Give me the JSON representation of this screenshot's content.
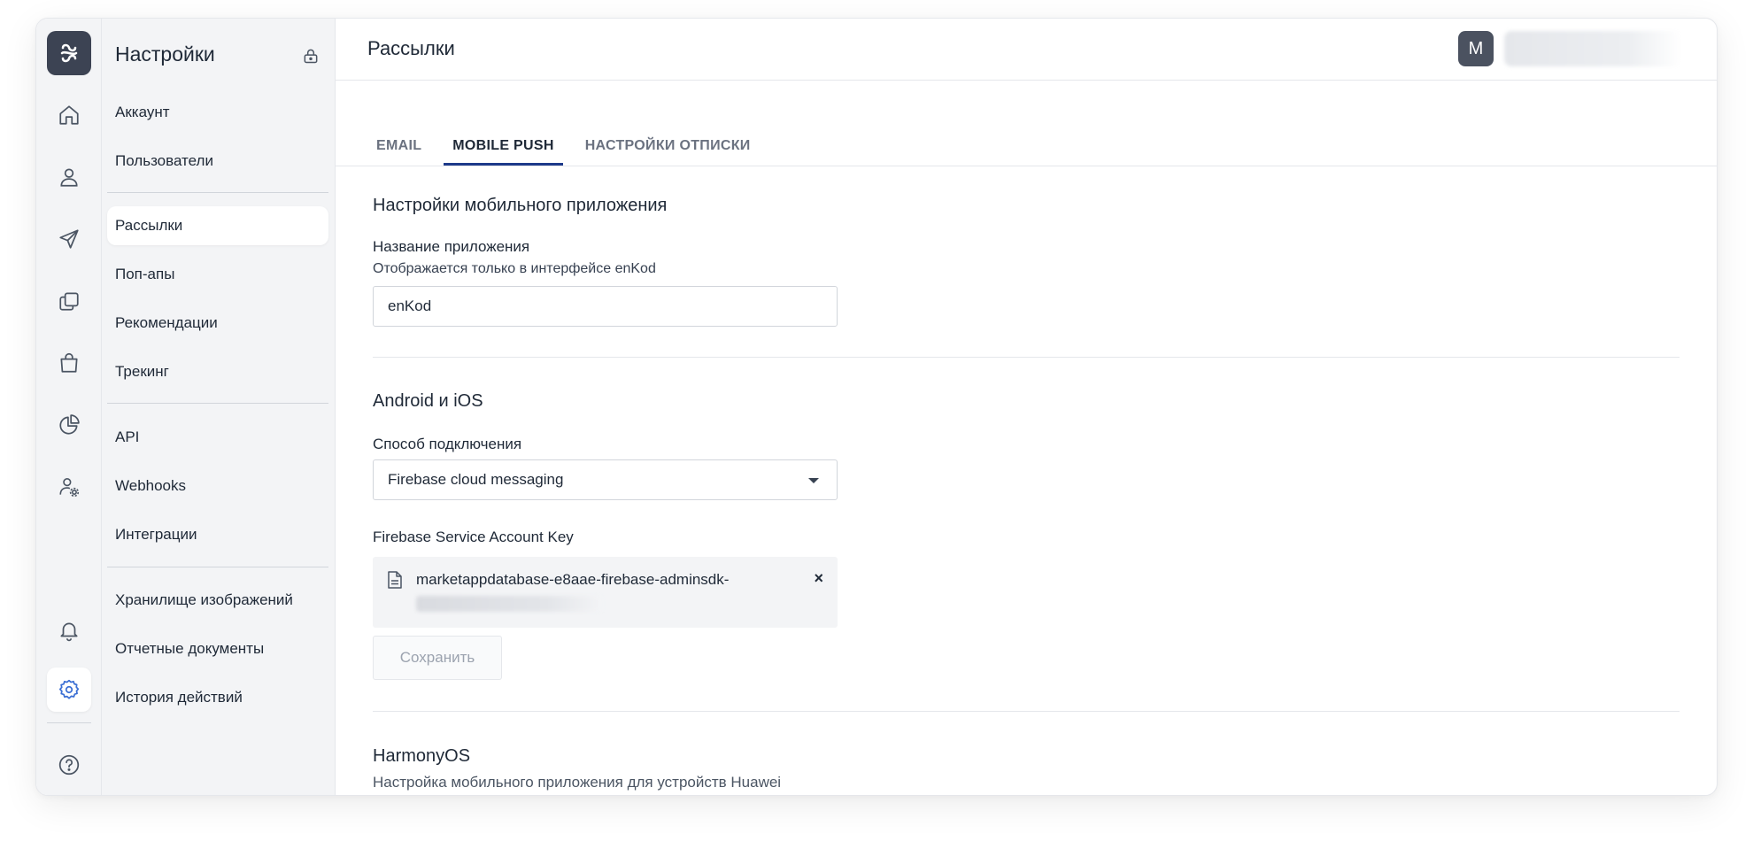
{
  "sidebar": {
    "title": "Настройки",
    "groups": [
      {
        "items": [
          "Аккаунт",
          "Пользователи"
        ]
      },
      {
        "items": [
          "Рассылки",
          "Поп-апы",
          "Рекомендации",
          "Трекинг"
        ]
      },
      {
        "items": [
          "API",
          "Webhooks",
          "Интеграции"
        ]
      },
      {
        "items": [
          "Хранилище изображений",
          "Отчетные документы",
          "История действий"
        ]
      }
    ],
    "active_item": "Рассылки"
  },
  "rail": {
    "icons": [
      "home-icon",
      "user-icon",
      "send-icon",
      "copy-icon",
      "bag-icon",
      "pie-chart-icon",
      "user-settings-icon",
      "bell-icon",
      "gear-icon",
      "help-icon"
    ],
    "active": "gear-icon",
    "accent": "#3b6fd4"
  },
  "header": {
    "title": "Рассылки",
    "avatar_letter": "M"
  },
  "tabs": [
    {
      "label": "EMAIL",
      "active": false
    },
    {
      "label": "MOBILE PUSH",
      "active": true
    },
    {
      "label": "НАСТРОЙКИ ОТПИСКИ",
      "active": false
    }
  ],
  "app_settings": {
    "title": "Настройки мобильного приложения",
    "name_label": "Название приложения",
    "name_hint": "Отображается только в интерфейсе enKod",
    "name_value": "enKod"
  },
  "android_ios": {
    "title": "Android и iOS",
    "connection_label": "Способ подключения",
    "connection_value": "Firebase cloud messaging",
    "key_label": "Firebase Service Account Key",
    "key_file_name": "marketappdatabase-e8aae-firebase-adminsdk-",
    "remove_glyph": "×",
    "save_label": "Сохранить"
  },
  "harmony": {
    "title": "HarmonyOS",
    "description": "Настройка мобильного приложения для устройств Huawei"
  }
}
